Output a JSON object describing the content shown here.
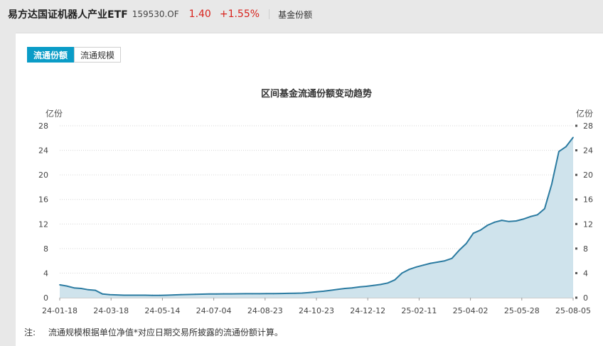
{
  "header": {
    "fund_name": "易方达国证机器人产业ETF",
    "fund_code": "159530.OF",
    "price": "1.40",
    "change_pct": "+1.55%",
    "section": "基金份额"
  },
  "tabs": [
    {
      "label": "流通份额",
      "active": true
    },
    {
      "label": "流通规模",
      "active": false
    }
  ],
  "note": {
    "label": "注:",
    "text": "流通规模根据单位净值*对应日期交易所披露的流通份额计算。"
  },
  "colors": {
    "accent": "#0a9cc7",
    "line": "#2b7ba1",
    "area": "#cfe3ec",
    "up": "#d8221c"
  },
  "chart_data": {
    "type": "area",
    "title": "区间基金流通份额变动趋势",
    "ylabel_left": "亿份",
    "ylabel_right": "亿份",
    "ylim": [
      0,
      28
    ],
    "yticks": [
      "0",
      "4",
      "8",
      "12",
      "16",
      "20",
      "24",
      "28"
    ],
    "xticks": [
      "24-01-18",
      "24-03-18",
      "24-05-14",
      "24-07-04",
      "24-08-23",
      "24-10-23",
      "24-12-12",
      "25-02-11",
      "25-04-02",
      "25-05-28",
      "25-08-05"
    ],
    "grid": true,
    "series": [
      {
        "values": [
          2.1,
          1.9,
          1.6,
          1.5,
          1.3,
          1.2,
          0.6,
          0.5,
          0.45,
          0.4,
          0.4,
          0.4,
          0.4,
          0.38,
          0.38,
          0.4,
          0.45,
          0.5,
          0.52,
          0.55,
          0.58,
          0.6,
          0.6,
          0.62,
          0.62,
          0.64,
          0.65,
          0.65,
          0.65,
          0.66,
          0.66,
          0.68,
          0.7,
          0.72,
          0.75,
          0.85,
          0.95,
          1.05,
          1.2,
          1.35,
          1.5,
          1.6,
          1.75,
          1.85,
          2.0,
          2.15,
          2.4,
          2.9,
          4.0,
          4.6,
          5.0,
          5.3,
          5.6,
          5.8,
          6.0,
          6.4,
          7.7,
          8.8,
          10.5,
          11.0,
          11.8,
          12.3,
          12.6,
          12.4,
          12.5,
          12.8,
          13.2,
          13.5,
          14.5,
          18.5,
          23.8,
          24.6,
          26.1
        ]
      }
    ]
  }
}
